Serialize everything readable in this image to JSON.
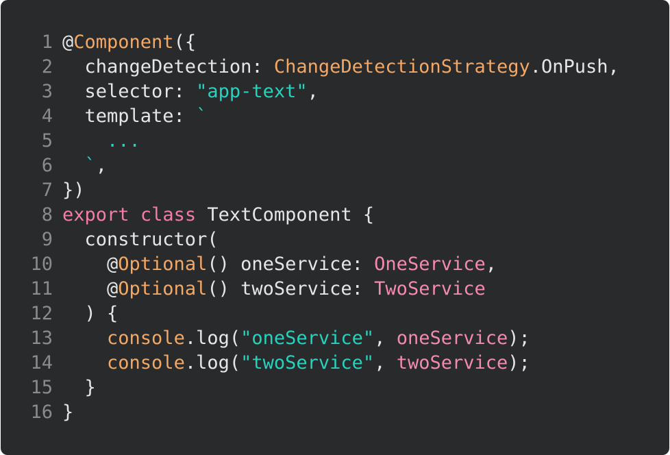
{
  "code_lines": [
    {
      "num": "1",
      "tokens": [
        {
          "t": "@",
          "k": "plain"
        },
        {
          "t": "Component",
          "k": "decorator"
        },
        {
          "t": "({",
          "k": "plain"
        }
      ]
    },
    {
      "num": "2",
      "tokens": [
        {
          "t": "  changeDetection: ",
          "k": "plain"
        },
        {
          "t": "ChangeDetectionStrategy",
          "k": "decorator"
        },
        {
          "t": ".OnPush,",
          "k": "plain"
        }
      ]
    },
    {
      "num": "3",
      "tokens": [
        {
          "t": "  selector: ",
          "k": "plain"
        },
        {
          "t": "\"app-text\"",
          "k": "string"
        },
        {
          "t": ",",
          "k": "plain"
        }
      ]
    },
    {
      "num": "4",
      "tokens": [
        {
          "t": "  template: ",
          "k": "plain"
        },
        {
          "t": "`",
          "k": "string"
        }
      ]
    },
    {
      "num": "5",
      "tokens": [
        {
          "t": "    ...",
          "k": "string"
        }
      ]
    },
    {
      "num": "6",
      "tokens": [
        {
          "t": "  `",
          "k": "string"
        },
        {
          "t": ",",
          "k": "plain"
        }
      ]
    },
    {
      "num": "7",
      "tokens": [
        {
          "t": "})",
          "k": "plain"
        }
      ]
    },
    {
      "num": "8",
      "tokens": [
        {
          "t": "export",
          "k": "keyword"
        },
        {
          "t": " ",
          "k": "plain"
        },
        {
          "t": "class",
          "k": "keyword"
        },
        {
          "t": " TextComponent {",
          "k": "plain"
        }
      ]
    },
    {
      "num": "9",
      "tokens": [
        {
          "t": "  constructor(",
          "k": "plain"
        }
      ]
    },
    {
      "num": "10",
      "tokens": [
        {
          "t": "    @",
          "k": "plain"
        },
        {
          "t": "Optional",
          "k": "decorator"
        },
        {
          "t": "() oneService: ",
          "k": "plain"
        },
        {
          "t": "OneService",
          "k": "type"
        },
        {
          "t": ",",
          "k": "plain"
        }
      ]
    },
    {
      "num": "11",
      "tokens": [
        {
          "t": "    @",
          "k": "plain"
        },
        {
          "t": "Optional",
          "k": "decorator"
        },
        {
          "t": "() twoService: ",
          "k": "plain"
        },
        {
          "t": "TwoService",
          "k": "type"
        }
      ]
    },
    {
      "num": "12",
      "tokens": [
        {
          "t": "  ) {",
          "k": "plain"
        }
      ]
    },
    {
      "num": "13",
      "tokens": [
        {
          "t": "    ",
          "k": "plain"
        },
        {
          "t": "console",
          "k": "decorator"
        },
        {
          "t": ".log(",
          "k": "plain"
        },
        {
          "t": "\"oneService\"",
          "k": "string"
        },
        {
          "t": ", ",
          "k": "plain"
        },
        {
          "t": "oneService",
          "k": "type"
        },
        {
          "t": ");",
          "k": "plain"
        }
      ]
    },
    {
      "num": "14",
      "tokens": [
        {
          "t": "    ",
          "k": "plain"
        },
        {
          "t": "console",
          "k": "decorator"
        },
        {
          "t": ".log(",
          "k": "plain"
        },
        {
          "t": "\"twoService\"",
          "k": "string"
        },
        {
          "t": ", ",
          "k": "plain"
        },
        {
          "t": "twoService",
          "k": "type"
        },
        {
          "t": ");",
          "k": "plain"
        }
      ]
    },
    {
      "num": "15",
      "tokens": [
        {
          "t": "  }",
          "k": "plain"
        }
      ]
    },
    {
      "num": "16",
      "tokens": [
        {
          "t": "}",
          "k": "plain"
        }
      ]
    }
  ],
  "colors": {
    "background": "#282a2c",
    "line_number": "#8b8b8b",
    "plain": "#e6e6e6",
    "decorator": "#f4a865",
    "string": "#27d3bd",
    "keyword": "#f47ca6",
    "type": "#f58ab0"
  }
}
